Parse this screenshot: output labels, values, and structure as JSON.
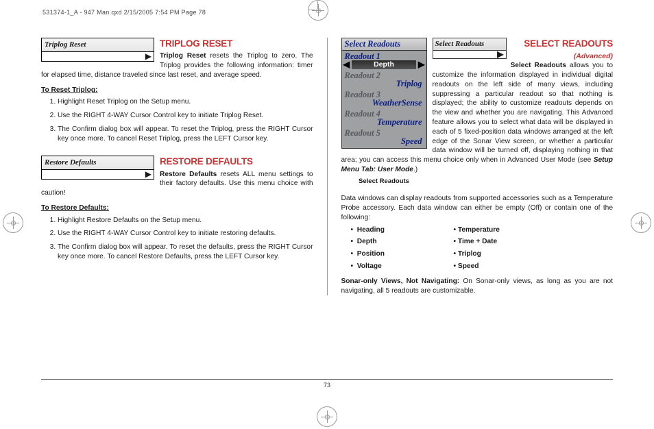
{
  "header": "531374-1_A - 947 Man.qxd  2/15/2005  7:54 PM  Page 78",
  "page_number": "73",
  "left": {
    "triplog": {
      "menu_title": "Triplog Reset",
      "heading": "TRIPLOG RESET",
      "lead_bold": "Triplog Reset",
      "lead_rest": " resets the Triplog to zero. The Triplog provides the following information: timer for elapsed time, distance traveled since last reset, and average speed.",
      "howto_title": "To Reset Triplog:",
      "steps": [
        "Highlight Reset Triplog on the Setup menu.",
        "Use the RIGHT 4-WAY Cursor Control key to initiate Triplog Reset.",
        "The Confirm dialog box will appear. To reset the Triplog, press the RIGHT Cursor key once more. To cancel Reset Triplog, press the LEFT Cursor key."
      ]
    },
    "restore": {
      "menu_title": "Restore Defaults",
      "heading": "RESTORE DEFAULTS",
      "lead_bold": "Restore Defaults",
      "lead_rest": " resets ALL menu settings to their factory defaults. Use this menu choice with caution!",
      "howto_title": "To Restore Defaults:",
      "steps": [
        "Highlight Restore Defaults on the Setup menu.",
        "Use the RIGHT 4-WAY Cursor Control key to initiate restoring defaults.",
        "The Confirm dialog box will appear. To reset the defaults, press the RIGHT Cursor key once more. To cancel Restore Defaults, press the LEFT Cursor key."
      ]
    }
  },
  "right": {
    "panel": {
      "title": "Select Readouts",
      "r1_label": "Readout 1",
      "r1_value": "Depth",
      "r2_label": "Readout 2",
      "r2_value": "Triplog",
      "r3_label": "Readout 3",
      "r3_value": "WeatherSense",
      "r4_label": "Readout 4",
      "r4_value": "Temperature",
      "r5_label": "Readout 5",
      "r5_value": "Speed",
      "caption": "Select Readouts"
    },
    "mini_title": "Select Readouts",
    "heading": "SELECT READOUTS",
    "advanced": "(Advanced)",
    "lead_bold": "Select Readouts",
    "body1": " allows you to customize the information displayed in individual digital readouts on the left side of many views, including suppressing a particular readout so that nothing is displayed; the ability to customize readouts depends on the view and whether you are navigating. This Advanced feature allows you to select what data will be displayed in each of 5 fixed-position data windows arranged at the left edge of the Sonar View screen, or whether a particular data window will be turned off, displaying nothing in that area; you can access this menu choice only when in Advanced User Mode (see ",
    "body1_ital": "Setup Menu Tab: User Mode",
    "body1_end": ".)",
    "body2": "Data windows can display readouts from supported accessories such as a Temperature Probe accessory. Each data window can either be empty (Off) or contain one of the following:",
    "list_left": [
      "Heading",
      "Depth",
      "Position",
      "Voltage"
    ],
    "list_right": [
      "Temperature",
      "Time + Date",
      "Triplog",
      "Speed"
    ],
    "footer_bold": "Sonar-only Views, Not Navigating:",
    "footer_rest": " On Sonar-only views, as long as you are not navigating, all 5 readouts are customizable."
  }
}
